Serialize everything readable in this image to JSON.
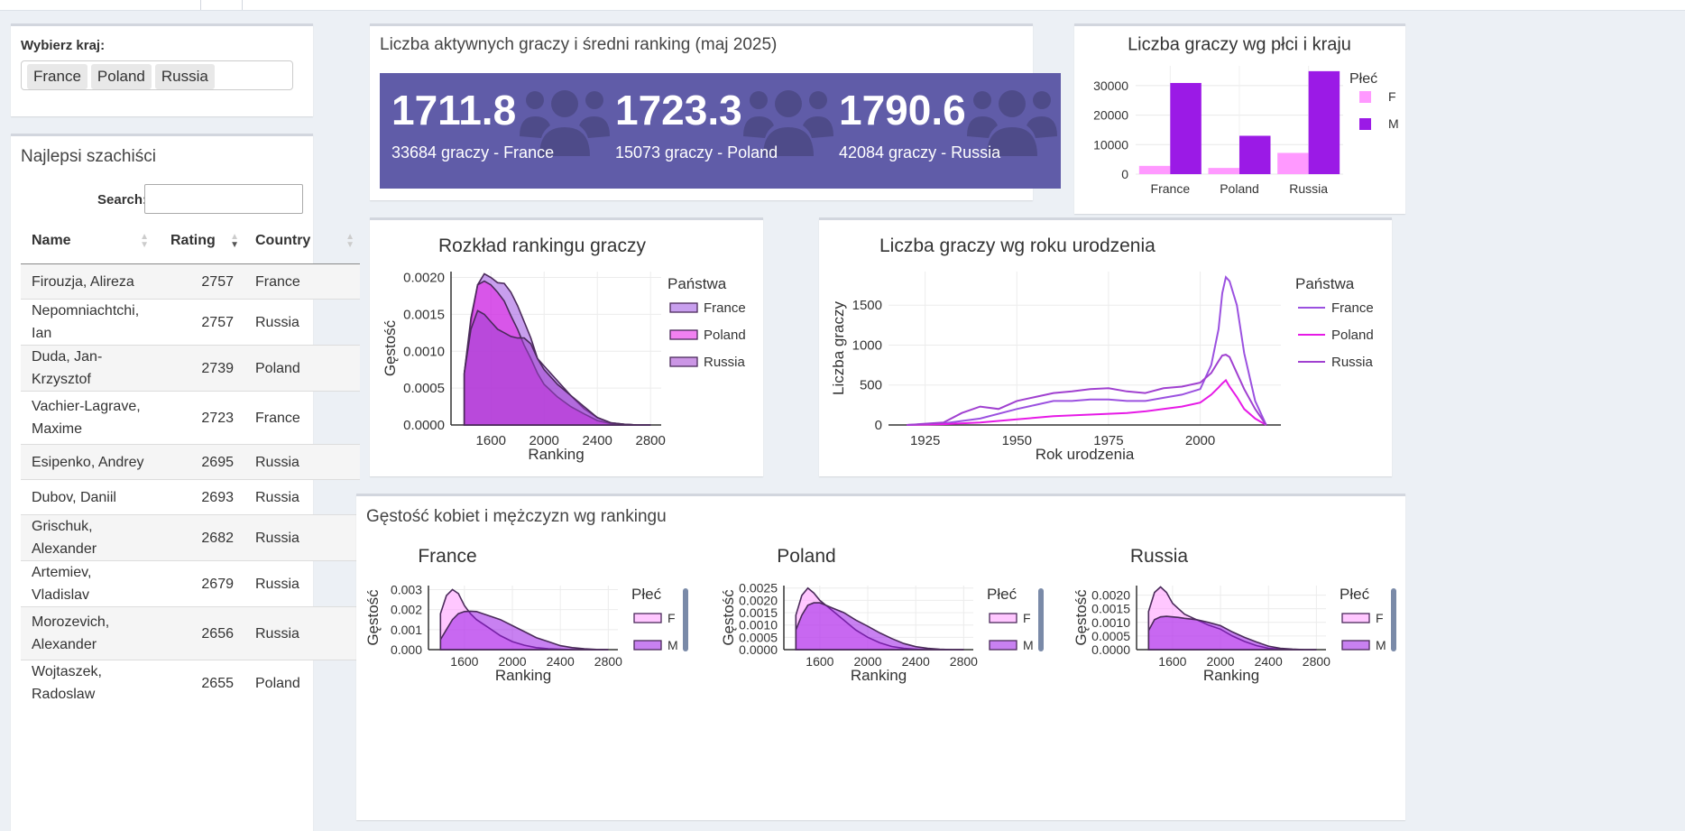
{
  "filter": {
    "label": "Wybierz kraj:",
    "selected": [
      "France",
      "Poland",
      "Russia"
    ]
  },
  "players_table": {
    "title": "Najlepsi szachiści",
    "search_label": "Search:",
    "columns": [
      "Name",
      "Rating",
      "Country"
    ],
    "rows": [
      {
        "name": "Firouzja, Alireza",
        "rating": "2757",
        "country": "France"
      },
      {
        "name": "Nepomniachtchi, Ian",
        "rating": "2757",
        "country": "Russia"
      },
      {
        "name": "Duda, Jan-Krzysztof",
        "rating": "2739",
        "country": "Poland"
      },
      {
        "name": "Vachier-Lagrave, Maxime",
        "rating": "2723",
        "country": "France"
      },
      {
        "name": "Esipenko, Andrey",
        "rating": "2695",
        "country": "Russia"
      },
      {
        "name": "Dubov, Daniil",
        "rating": "2693",
        "country": "Russia"
      },
      {
        "name": "Grischuk, Alexander",
        "rating": "2682",
        "country": "Russia"
      },
      {
        "name": "Artemiev, Vladislav",
        "rating": "2679",
        "country": "Russia"
      },
      {
        "name": "Morozevich, Alexander",
        "rating": "2656",
        "country": "Russia"
      },
      {
        "name": "Wojtaszek, Radoslaw",
        "rating": "2655",
        "country": "Poland"
      }
    ]
  },
  "summary": {
    "title": "Liczba aktywnych graczy i średni ranking (maj 2025)",
    "cards": [
      {
        "value": "1711.8",
        "label": "33684 graczy - France"
      },
      {
        "value": "1723.3",
        "label": "15073 graczy - Poland"
      },
      {
        "value": "1790.6",
        "label": "42084 graczy - Russia"
      }
    ],
    "icon": "users-icon",
    "card_color": "#605ca8"
  },
  "colors": {
    "France": "#9b51e0",
    "Poland": "#e61ae6",
    "Russia": "#a040d0",
    "F": "#ff99ff",
    "M": "#9b1ae6"
  },
  "chart_data": [
    {
      "type": "bar",
      "title": "Liczba graczy wg płci i kraju",
      "legend_title": "Płeć",
      "legend_position": "right",
      "categories": [
        "France",
        "Poland",
        "Russia"
      ],
      "series": [
        {
          "name": "F",
          "values": [
            2800,
            2100,
            7200
          ]
        },
        {
          "name": "M",
          "values": [
            30900,
            13000,
            34900
          ]
        }
      ],
      "yticks": [
        0,
        10000,
        20000,
        30000
      ],
      "ylim": [
        0,
        36700
      ],
      "grid": true
    },
    {
      "type": "area",
      "title": "Rozkład rankingu graczy",
      "xlabel": "Ranking",
      "ylabel": "Gęstość",
      "legend_title": "Państwa",
      "legend_position": "right",
      "xticks": [
        1600,
        2000,
        2400,
        2800
      ],
      "yticks": [
        "0.0000",
        "0.0005",
        "0.0010",
        "0.0015",
        "0.0020"
      ],
      "xlim": [
        1300,
        2880
      ],
      "ylim": [
        0,
        0.00208
      ],
      "grid": true,
      "series": [
        {
          "name": "France",
          "x": [
            1400,
            1450,
            1500,
            1550,
            1600,
            1650,
            1700,
            1750,
            1800,
            1850,
            1900,
            1950,
            2000,
            2100,
            2200,
            2300,
            2400,
            2500,
            2600,
            2700,
            2800
          ],
          "y": [
            0.0007,
            0.0014,
            0.0019,
            0.00205,
            0.002,
            0.00193,
            0.00192,
            0.0018,
            0.00162,
            0.0014,
            0.00118,
            0.0009,
            0.0008,
            0.0006,
            0.0004,
            0.00022,
            0.0001,
            3e-05,
            1e-05,
            0,
            0
          ]
        },
        {
          "name": "Poland",
          "x": [
            1400,
            1450,
            1500,
            1550,
            1600,
            1650,
            1700,
            1750,
            1800,
            1850,
            1900,
            1950,
            2000,
            2100,
            2200,
            2300,
            2400,
            2500,
            2600,
            2700,
            2800
          ],
          "y": [
            0.0007,
            0.00145,
            0.0019,
            0.00195,
            0.0019,
            0.0018,
            0.00168,
            0.00148,
            0.0013,
            0.00108,
            0.0009,
            0.0007,
            0.00055,
            0.00038,
            0.00025,
            0.00015,
            6e-05,
            2e-05,
            1e-05,
            0,
            0
          ]
        },
        {
          "name": "Russia",
          "x": [
            1400,
            1450,
            1500,
            1550,
            1600,
            1650,
            1700,
            1750,
            1800,
            1850,
            1900,
            1950,
            2000,
            2100,
            2200,
            2300,
            2400,
            2500,
            2600,
            2700,
            2800
          ],
          "y": [
            0.0007,
            0.0013,
            0.00155,
            0.0015,
            0.0014,
            0.0013,
            0.00125,
            0.0012,
            0.00118,
            0.00118,
            0.0011,
            0.0009,
            0.00075,
            0.00055,
            0.0004,
            0.00025,
            0.0001,
            3e-05,
            1e-05,
            0,
            0
          ]
        }
      ]
    },
    {
      "type": "line",
      "title": "Liczba graczy wg roku urodzenia",
      "xlabel": "Rok urodzenia",
      "ylabel": "Liczba graczy",
      "legend_title": "Państwa",
      "legend_position": "right",
      "xticks": [
        1925,
        1950,
        1975,
        2000
      ],
      "yticks": [
        0,
        500,
        1000,
        1500
      ],
      "xlim": [
        1915,
        2022
      ],
      "ylim": [
        0,
        1920
      ],
      "grid": true,
      "series": [
        {
          "name": "France",
          "x": [
            1920,
            1930,
            1940,
            1950,
            1955,
            1960,
            1965,
            1970,
            1975,
            1980,
            1985,
            1990,
            1995,
            2000,
            2003,
            2005,
            2006,
            2007,
            2008,
            2010,
            2012,
            2015,
            2018
          ],
          "y": [
            0,
            20,
            80,
            200,
            250,
            300,
            300,
            320,
            320,
            300,
            300,
            340,
            380,
            450,
            750,
            1200,
            1650,
            1850,
            1800,
            1500,
            900,
            300,
            0
          ]
        },
        {
          "name": "Poland",
          "x": [
            1920,
            1930,
            1940,
            1950,
            1955,
            1960,
            1965,
            1970,
            1975,
            1980,
            1985,
            1990,
            1995,
            2000,
            2003,
            2005,
            2006,
            2007,
            2008,
            2010,
            2012,
            2015,
            2018
          ],
          "y": [
            0,
            10,
            30,
            70,
            90,
            110,
            120,
            130,
            140,
            150,
            170,
            200,
            230,
            280,
            380,
            470,
            520,
            560,
            480,
            350,
            200,
            80,
            0
          ]
        },
        {
          "name": "Russia",
          "x": [
            1920,
            1930,
            1935,
            1940,
            1945,
            1950,
            1955,
            1960,
            1965,
            1970,
            1975,
            1980,
            1985,
            1990,
            1995,
            2000,
            2003,
            2005,
            2006,
            2007,
            2008,
            2010,
            2012,
            2015,
            2018
          ],
          "y": [
            0,
            30,
            150,
            230,
            200,
            300,
            350,
            400,
            420,
            450,
            460,
            420,
            400,
            460,
            480,
            530,
            650,
            800,
            870,
            880,
            850,
            650,
            450,
            200,
            0
          ]
        }
      ]
    },
    {
      "type": "area",
      "panel_title": "Gęstość kobiet i mężczyzn wg rankingu",
      "title": "France",
      "xlabel": "Ranking",
      "ylabel": "Gęstość",
      "legend_title": "Płeć",
      "legend_position": "right",
      "xticks": [
        1600,
        2000,
        2400,
        2800
      ],
      "yticks": [
        "0.000",
        "0.001",
        "0.002",
        "0.003"
      ],
      "xlim": [
        1300,
        2880
      ],
      "ylim": [
        0,
        0.0032
      ],
      "grid": true,
      "series": [
        {
          "name": "F",
          "x": [
            1400,
            1450,
            1500,
            1550,
            1600,
            1650,
            1700,
            1800,
            1900,
            2000,
            2100,
            2200,
            2300,
            2400,
            2500,
            2600,
            2700,
            2800
          ],
          "y": [
            0.0018,
            0.0027,
            0.003,
            0.0028,
            0.0022,
            0.0018,
            0.0015,
            0.0011,
            0.0007,
            0.0004,
            0.00022,
            0.0001,
            4e-05,
            2e-05,
            0,
            0,
            0,
            0
          ]
        },
        {
          "name": "M",
          "x": [
            1400,
            1450,
            1500,
            1550,
            1600,
            1650,
            1700,
            1800,
            1900,
            2000,
            2100,
            2200,
            2300,
            2400,
            2500,
            2600,
            2700,
            2800
          ],
          "y": [
            0.0005,
            0.001,
            0.0015,
            0.0018,
            0.0019,
            0.00192,
            0.0019,
            0.0017,
            0.0015,
            0.0012,
            0.0009,
            0.0006,
            0.0004,
            0.0002,
            0.0001,
            4e-05,
            1e-05,
            0
          ]
        }
      ]
    },
    {
      "type": "area",
      "title": "Poland",
      "xlabel": "Ranking",
      "ylabel": "Gęstość",
      "legend_title": "Płeć",
      "legend_position": "right",
      "xticks": [
        1600,
        2000,
        2400,
        2800
      ],
      "yticks": [
        "0.0000",
        "0.0005",
        "0.0010",
        "0.0015",
        "0.0020",
        "0.0025"
      ],
      "xlim": [
        1300,
        2880
      ],
      "ylim": [
        0,
        0.0026
      ],
      "grid": true,
      "series": [
        {
          "name": "F",
          "x": [
            1400,
            1450,
            1500,
            1550,
            1600,
            1650,
            1700,
            1800,
            1900,
            2000,
            2100,
            2200,
            2300,
            2400,
            2500,
            2600,
            2700,
            2800
          ],
          "y": [
            0.0014,
            0.0022,
            0.0025,
            0.0023,
            0.002,
            0.0018,
            0.0016,
            0.0012,
            0.0008,
            0.0005,
            0.00028,
            0.00013,
            5e-05,
            2e-05,
            0,
            0,
            0,
            0
          ]
        },
        {
          "name": "M",
          "x": [
            1400,
            1450,
            1500,
            1550,
            1600,
            1650,
            1700,
            1800,
            1900,
            2000,
            2100,
            2200,
            2300,
            2400,
            2500,
            2600,
            2700,
            2800
          ],
          "y": [
            0.0008,
            0.0014,
            0.0018,
            0.0019,
            0.0019,
            0.0018,
            0.0017,
            0.0015,
            0.0012,
            0.00095,
            0.00068,
            0.00045,
            0.00025,
            0.00012,
            5e-05,
            2e-05,
            0,
            0
          ]
        }
      ]
    },
    {
      "type": "area",
      "title": "Russia",
      "xlabel": "Ranking",
      "ylabel": "Gęstość",
      "legend_title": "Płeć",
      "legend_position": "right",
      "xticks": [
        1600,
        2000,
        2400,
        2800
      ],
      "yticks": [
        "0.0000",
        "0.0005",
        "0.0010",
        "0.0015",
        "0.0020"
      ],
      "xlim": [
        1300,
        2880
      ],
      "ylim": [
        0,
        0.00235
      ],
      "grid": true,
      "series": [
        {
          "name": "F",
          "x": [
            1400,
            1450,
            1500,
            1550,
            1600,
            1650,
            1700,
            1800,
            1900,
            2000,
            2100,
            2200,
            2300,
            2400,
            2500,
            2600,
            2700,
            2800
          ],
          "y": [
            0.0014,
            0.0021,
            0.0023,
            0.0021,
            0.0017,
            0.0015,
            0.0013,
            0.0011,
            0.0009,
            0.00075,
            0.0005,
            0.0003,
            0.00015,
            5e-05,
            2e-05,
            0,
            0,
            0
          ]
        },
        {
          "name": "M",
          "x": [
            1400,
            1450,
            1500,
            1550,
            1600,
            1650,
            1700,
            1800,
            1900,
            2000,
            2100,
            2200,
            2300,
            2400,
            2500,
            2600,
            2700,
            2800
          ],
          "y": [
            0.0007,
            0.0011,
            0.0012,
            0.00122,
            0.0012,
            0.00118,
            0.00115,
            0.0011,
            0.001,
            0.00088,
            0.00065,
            0.00045,
            0.00028,
            0.00013,
            5e-05,
            2e-05,
            0,
            0
          ]
        }
      ]
    }
  ]
}
